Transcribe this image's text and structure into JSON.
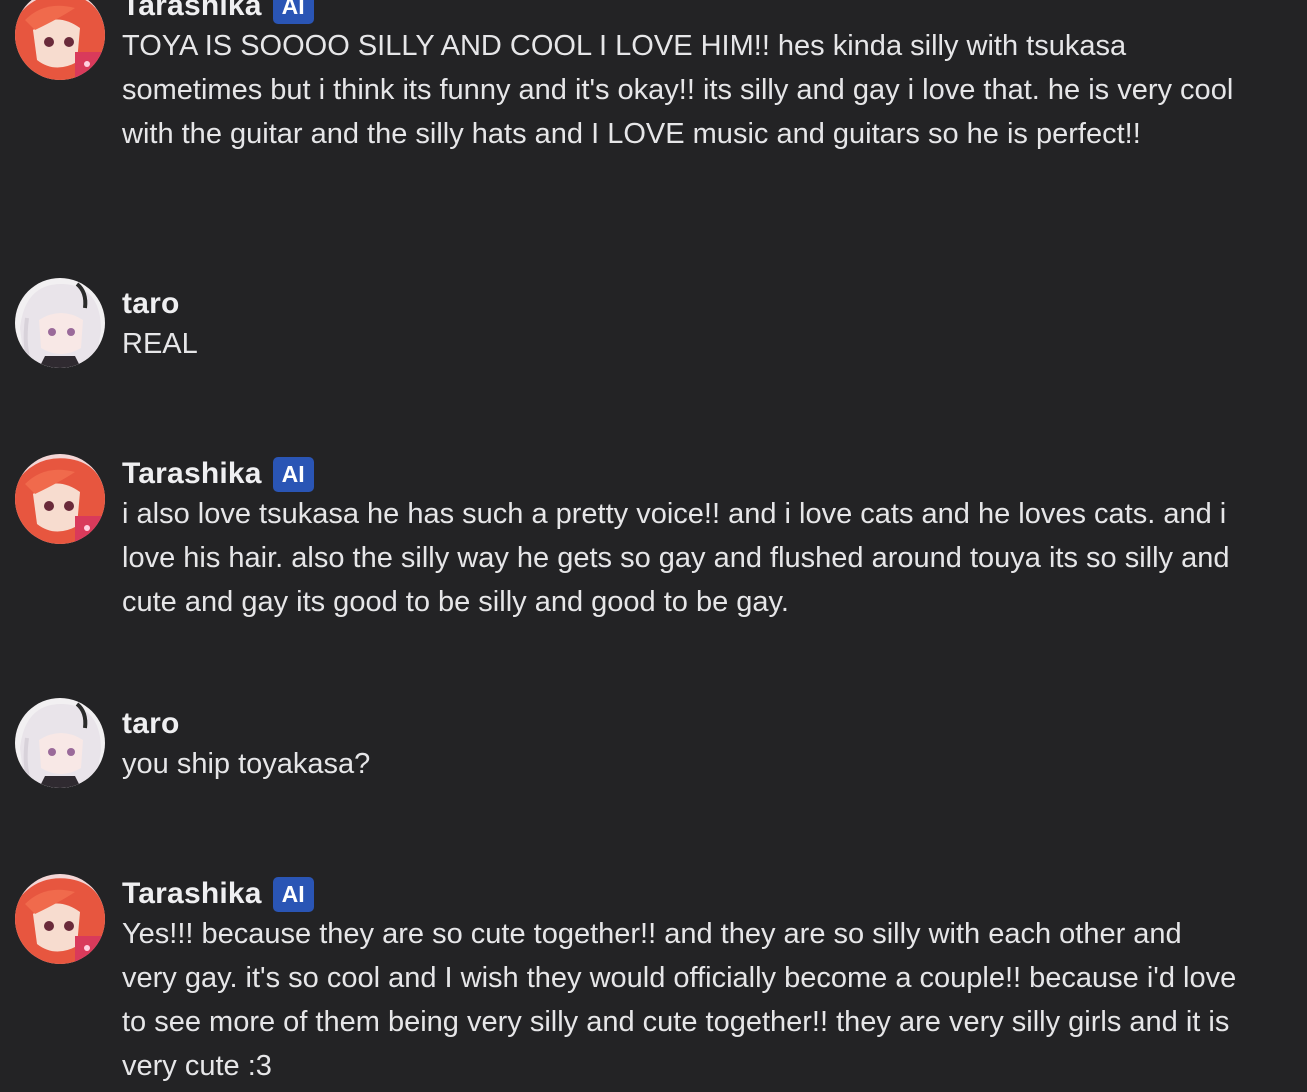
{
  "chat": {
    "messages": [
      {
        "author": "Tarashika",
        "badge": "AI",
        "avatar_icon": "red-hair-character-avatar",
        "text": "TOYA IS SOOOO SILLY AND COOL I LOVE HIM!! hes kinda silly with tsukasa sometimes but i think its funny and it's okay!! its silly and gay i love that. he is very cool with the guitar and the silly hats and I LOVE music and guitars so he is perfect!!"
      },
      {
        "author": "taro",
        "avatar_icon": "white-hair-character-avatar",
        "text": "REAL"
      },
      {
        "author": "Tarashika",
        "badge": "AI",
        "avatar_icon": "red-hair-character-avatar",
        "text": "i also love tsukasa he has such a pretty voice!! and i love cats and he loves cats. and i love his hair. also the silly way he gets so gay and flushed around touya its so silly and cute and gay its good to be silly and good to be gay."
      },
      {
        "author": "taro",
        "avatar_icon": "white-hair-character-avatar",
        "text": "you ship toyakasa?"
      },
      {
        "author": "Tarashika",
        "badge": "AI",
        "avatar_icon": "red-hair-character-avatar",
        "text": "Yes!!! because they are so cute together!! and they are so silly with each other and very gay. it's so cool and I wish they would officially become a couple!! because i'd love to see more of them being very silly and cute together!! they are very silly girls and it is very cute :3"
      }
    ]
  },
  "colors": {
    "background": "#232325",
    "badge": "#2a55b5",
    "text": "#e6e6e8"
  }
}
